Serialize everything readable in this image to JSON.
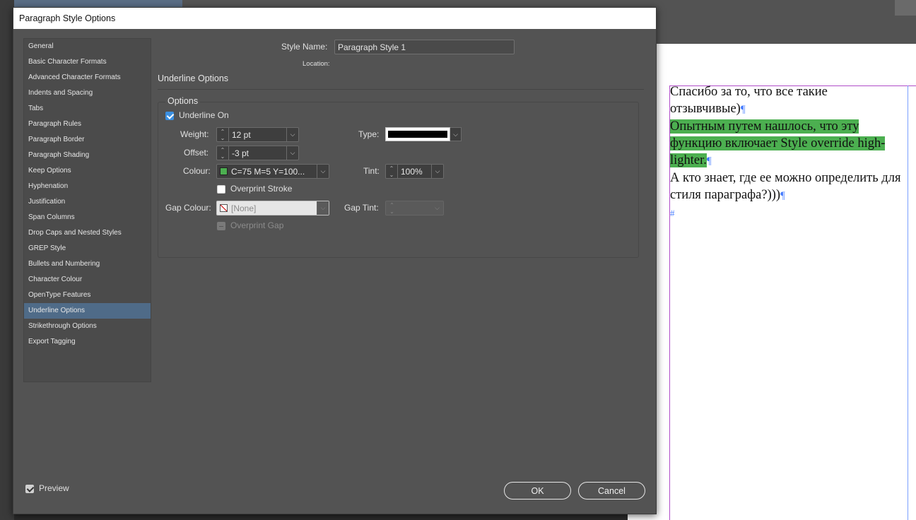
{
  "dialog": {
    "title": "Paragraph Style Options",
    "style_name_label": "Style Name:",
    "style_name_value": "Paragraph Style 1",
    "location_label": "Location:",
    "section_title": "Underline Options",
    "group_title": "Options"
  },
  "sidebar": {
    "items": [
      {
        "label": "General"
      },
      {
        "label": "Basic Character Formats"
      },
      {
        "label": "Advanced Character Formats"
      },
      {
        "label": "Indents and Spacing"
      },
      {
        "label": "Tabs"
      },
      {
        "label": "Paragraph Rules"
      },
      {
        "label": "Paragraph Border"
      },
      {
        "label": "Paragraph Shading"
      },
      {
        "label": "Keep Options"
      },
      {
        "label": "Hyphenation"
      },
      {
        "label": "Justification"
      },
      {
        "label": "Span Columns"
      },
      {
        "label": "Drop Caps and Nested Styles"
      },
      {
        "label": "GREP Style"
      },
      {
        "label": "Bullets and Numbering"
      },
      {
        "label": "Character Colour"
      },
      {
        "label": "OpenType Features"
      },
      {
        "label": "Underline Options"
      },
      {
        "label": "Strikethrough Options"
      },
      {
        "label": "Export Tagging"
      }
    ],
    "selected": "Underline Options"
  },
  "options": {
    "underline_on_label": "Underline On",
    "underline_on_checked": true,
    "weight_label": "Weight:",
    "weight_value": "12 pt",
    "type_label": "Type:",
    "offset_label": "Offset:",
    "offset_value": "-3 pt",
    "colour_label": "Colour:",
    "colour_value": "C=75 M=5 Y=100...",
    "colour_swatch": "#4caf50",
    "tint_label": "Tint:",
    "tint_value": "100%",
    "overprint_stroke_label": "Overprint Stroke",
    "overprint_stroke_checked": false,
    "gap_colour_label": "Gap Colour:",
    "gap_colour_value": "[None]",
    "gap_tint_label": "Gap Tint:",
    "overprint_gap_label": "Overprint Gap"
  },
  "footer": {
    "preview_label": "Preview",
    "preview_checked": true,
    "ok_label": "OK",
    "cancel_label": "Cancel"
  },
  "document": {
    "line1": "Спасибо за то, что все такие отзывчивые)",
    "highlighted": "Опытным путем нашлось, что эту функцию включает Style override high-lighter.",
    "line3": "А кто знает, где ее можно определить для стиля параграфа?)))",
    "pilcrow": "¶",
    "end_mark": "#",
    "highlight_color": "#4caf50"
  }
}
